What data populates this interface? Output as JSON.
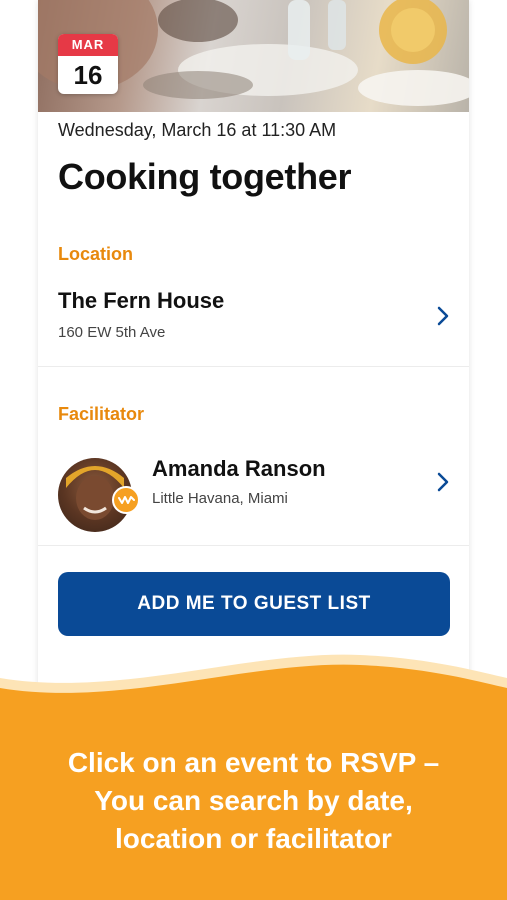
{
  "event": {
    "date_badge": {
      "month": "MAR",
      "day": "16"
    },
    "datetime": "Wednesday, March 16 at 11:30 AM",
    "title": "Cooking together"
  },
  "location": {
    "section_label": "Location",
    "name": "The Fern House",
    "address": "160 EW 5th Ave"
  },
  "facilitator": {
    "section_label": "Facilitator",
    "name": "Amanda Ranson",
    "area": "Little Havana, Miami"
  },
  "cta": {
    "label": "ADD ME TO GUEST LIST"
  },
  "promo": {
    "lines": [
      "Click on an event to RSVP –",
      "You can search by date,",
      "location or facilitator"
    ]
  },
  "colors": {
    "accent_orange": "#e8890d",
    "wave_orange": "#f6a021",
    "button_blue": "#0a4a96",
    "badge_red": "#e63946"
  },
  "icons": {
    "chevron": "chevron-right-icon",
    "badge": "wave-logo-icon"
  }
}
